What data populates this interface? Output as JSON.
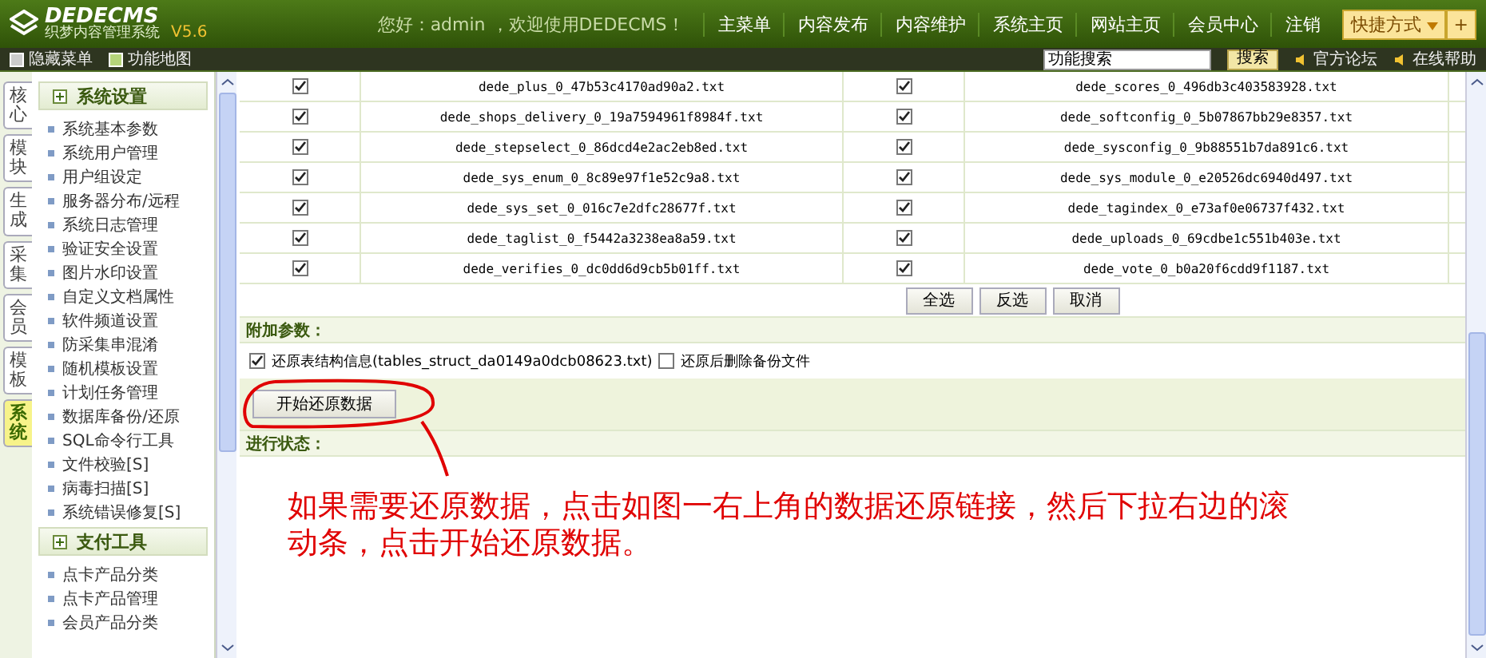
{
  "header": {
    "logo": "DEDECMS",
    "subtitle": "织梦内容管理系统",
    "version": "V5.6",
    "greeting": "您好：admin ，欢迎使用DEDECMS！",
    "nav": [
      "主菜单",
      "内容发布",
      "内容维护",
      "系统主页",
      "网站主页",
      "会员中心",
      "注销"
    ],
    "quick_menu": "快捷方式",
    "quick_add": "+"
  },
  "toolbar": {
    "left": [
      "隐藏菜单",
      "功能地图"
    ],
    "search": {
      "value": "功能搜索"
    },
    "search_button": "搜索",
    "links": [
      "官方论坛",
      "在线帮助"
    ]
  },
  "side_tabs": [
    {
      "label": "核心",
      "selected": false
    },
    {
      "label": "模块",
      "selected": false
    },
    {
      "label": "生成",
      "selected": false
    },
    {
      "label": "采集",
      "selected": false
    },
    {
      "label": "会员",
      "selected": false
    },
    {
      "label": "模板",
      "selected": false
    },
    {
      "label": "系统",
      "selected": true
    }
  ],
  "sidebar": [
    {
      "title": "系统设置",
      "items": [
        "系统基本参数",
        "系统用户管理",
        "用户组设定",
        "服务器分布/远程",
        "系统日志管理",
        "验证安全设置",
        "图片水印设置",
        "自定义文档属性",
        "软件频道设置",
        "防采集串混淆",
        "随机模板设置",
        "计划任务管理",
        "数据库备份/还原",
        "SQL命令行工具",
        "文件校验[S]",
        "病毒扫描[S]",
        "系统错误修复[S]"
      ]
    },
    {
      "title": "支付工具",
      "items": [
        "点卡产品分类",
        "点卡产品管理",
        "会员产品分类"
      ]
    }
  ],
  "files": [
    {
      "checked": true,
      "name": "dede_plus_0_47b53c4170ad90a2.txt",
      "checked2": true,
      "name2": "dede_scores_0_496db3c403583928.txt"
    },
    {
      "checked": true,
      "name": "dede_shops_delivery_0_19a7594961f8984f.txt",
      "checked2": true,
      "name2": "dede_softconfig_0_5b07867bb29e8357.txt"
    },
    {
      "checked": true,
      "name": "dede_stepselect_0_86dcd4e2ac2eb8ed.txt",
      "checked2": true,
      "name2": "dede_sysconfig_0_9b88551b7da891c6.txt"
    },
    {
      "checked": true,
      "name": "dede_sys_enum_0_8c89e97f1e52c9a8.txt",
      "checked2": true,
      "name2": "dede_sys_module_0_e20526dc6940d497.txt"
    },
    {
      "checked": true,
      "name": "dede_sys_set_0_016c7e2dfc28677f.txt",
      "checked2": true,
      "name2": "dede_tagindex_0_e73af0e06737f432.txt"
    },
    {
      "checked": true,
      "name": "dede_taglist_0_f5442a3238ea8a59.txt",
      "checked2": true,
      "name2": "dede_uploads_0_69cdbe1c551b403e.txt"
    },
    {
      "checked": true,
      "name": "dede_verifies_0_dc0dd6d9cb5b01ff.txt",
      "checked2": true,
      "name2": "dede_vote_0_b0a20f6cdd9f1187.txt"
    }
  ],
  "select_buttons": [
    "全选",
    "反选",
    "取消"
  ],
  "extra_params": {
    "heading": "附加参数：",
    "options": [
      {
        "label": "还原表结构信息(tables_struct_da0149a0dcb08623.txt)",
        "checked": true
      },
      {
        "label": "还原后删除备份文件",
        "checked": false
      }
    ],
    "start_button": "开始还原数据"
  },
  "progress": {
    "heading": "进行状态："
  },
  "annotation": "如果需要还原数据，点击如图一右上角的数据还原链接，然后下拉右边的滚动条，点击开始还原数据。"
}
